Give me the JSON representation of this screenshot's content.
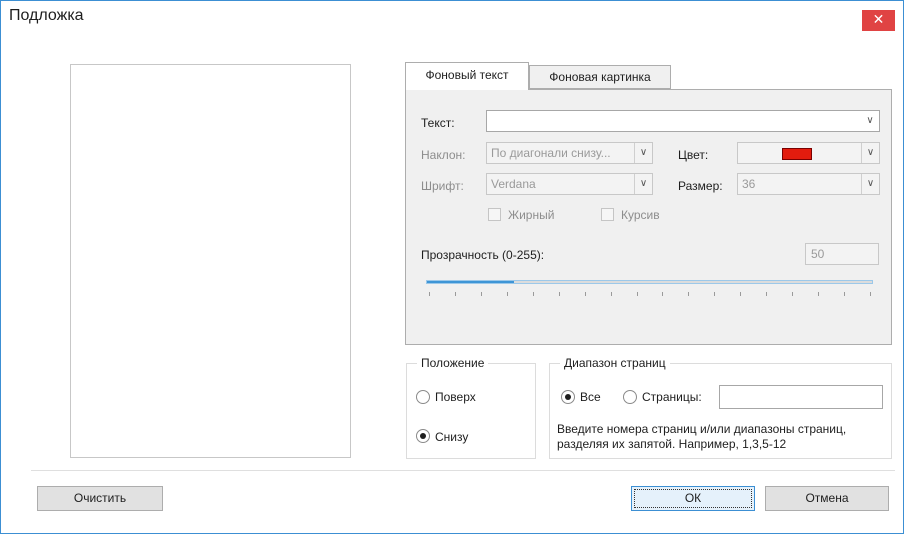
{
  "window": {
    "title": "Подложка",
    "close_glyph": "✕"
  },
  "tabs": [
    {
      "label": "Фоновый текст",
      "active": true
    },
    {
      "label": "Фоновая картинка",
      "active": false
    }
  ],
  "text_tab": {
    "text_label": "Текст:",
    "text_value": "",
    "angle_label": "Наклон:",
    "angle_value": "По диагонали снизу...",
    "color_label": "Цвет:",
    "color_value": "#e31c0e",
    "font_label": "Шрифт:",
    "font_value": "Verdana",
    "size_label": "Размер:",
    "size_value": "36",
    "bold_label": "Жирный",
    "italic_label": "Курсив",
    "transparency_label": "Прозрачность (0-255):",
    "transparency_value": "50",
    "transparency_fraction": 0.196
  },
  "position_group": {
    "legend": "Положение",
    "options": [
      {
        "label": "Поверх",
        "checked": false
      },
      {
        "label": "Снизу",
        "checked": true
      }
    ]
  },
  "range_group": {
    "legend": "Диапазон страниц",
    "all_label": "Все",
    "pages_label": "Страницы:",
    "pages_value": "",
    "hint": "Введите номера страниц и/или диапазоны страниц, разделяя их запятой. Например, 1,3,5-12"
  },
  "buttons": {
    "clear": "Очистить",
    "ok": "ОК",
    "cancel": "Отмена"
  },
  "icons": {
    "dropdown": "chevron-down-icon",
    "close": "close-icon"
  }
}
